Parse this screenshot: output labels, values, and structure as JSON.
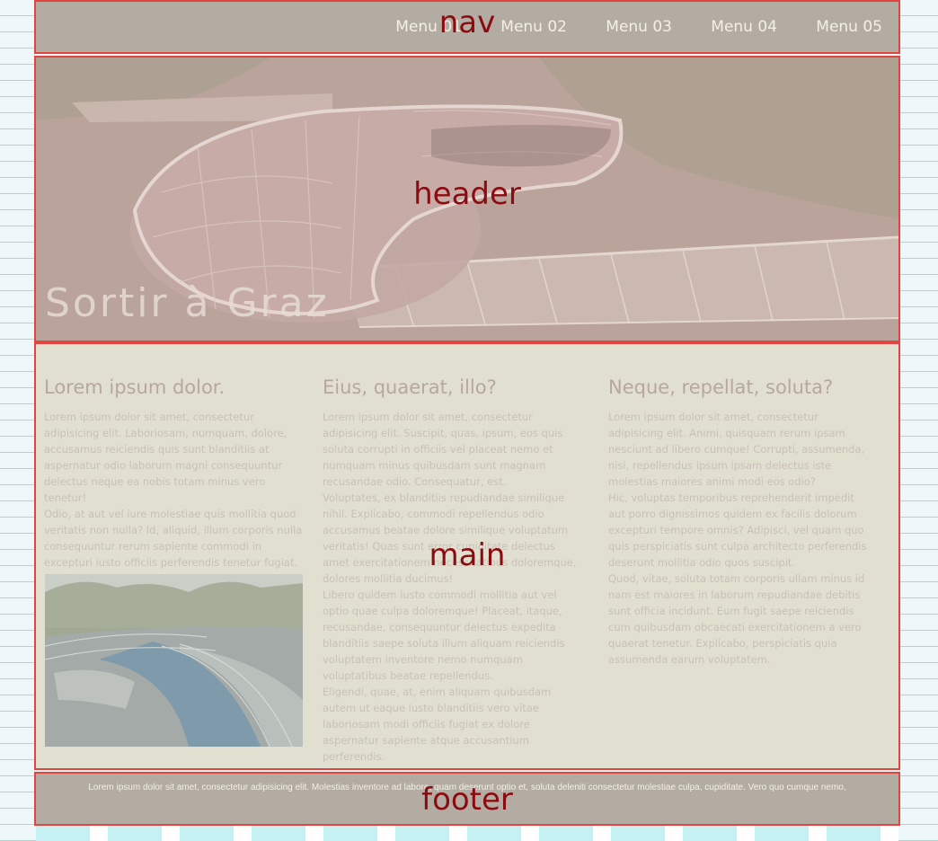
{
  "nav": {
    "label": "nav",
    "menu": [
      "Menu 01",
      "Menu 02",
      "Menu 03",
      "Menu 04",
      "Menu 05"
    ]
  },
  "header": {
    "label": "header",
    "title": "Sortir à Graz"
  },
  "main": {
    "label": "main",
    "columns": [
      {
        "heading": "Lorem ipsum dolor.",
        "paragraphs": [
          "Lorem ipsum dolor sit amet, consectetur adipisicing elit. Laboriosam, numquam, dolore, accusamus reiciendis quis sunt blanditiis at aspernatur odio laborum magni consequuntur delectus neque ea nobis totam minus vero tenetur!",
          "Odio, at aut vel iure molestiae quis mollitia quod veritatis non nulla? Id, aliquid, illum corporis nulla consequuntur rerum sapiente commodi in excepturi iusto officiis perferendis tenetur fugiat. Rem, modi?"
        ]
      },
      {
        "heading": "Eius, quaerat, illo?",
        "paragraphs": [
          "Lorem ipsum dolor sit amet, consectetur adipisicing elit. Suscipit, quas, ipsum, eos quis soluta corrupti in officiis vel placeat nemo et numquam minus quibusdam sunt magnam recusandae odio. Consequatur, est.",
          "Voluptates, ex blanditiis repudiandae similique nihil. Explicabo, commodi repellendus odio accusamus beatae dolore similique voluptatum veritatis! Quas sunt error cupiditate delectus amet exercitationem necessitatibus doloremque, dolores mollitia ducimus!",
          "Libero quidem iusto commodi mollitia aut vel optio quae culpa doloremque! Placeat, itaque, recusandae, consequuntur delectus expedita blanditiis saepe soluta illum aliquam reiciendis voluptatem inventore nemo numquam voluptatibus beatae repellendus.",
          "Eligendi, quae, at, enim aliquam quibusdam autem ut eaque iusto blanditiis vero vitae laboriosam modi officiis fugiat ex dolore aspernatur sapiente atque accusantium perferendis."
        ]
      },
      {
        "heading": "Neque, repellat, soluta?",
        "paragraphs": [
          "Lorem ipsum dolor sit amet, consectetur adipisicing elit. Animi, quisquam rerum ipsam nesciunt ad libero cumque! Corrupti, assumenda, nisi, repellendus ipsum ipsam delectus iste molestias maiores animi modi eos odio?",
          "Hic, voluptas temporibus reprehenderit impedit aut porro dignissimos quidem ex facilis dolorum excepturi tempore omnis? Adipisci, vel quam quo quis perspiciatis sunt culpa architecto perferendis deserunt mollitia odio quos suscipit.",
          "Quod, vitae, soluta totam corporis ullam minus id nam est maiores in laborum repudiandae debitis sunt officia incidunt. Eum fugit saepe reiciendis cum quibusdam obcaecati exercitationem a vero quaerat tenetur. Explicabo, perspiciatis quia assumenda earum voluptatem."
        ]
      }
    ]
  },
  "footer": {
    "label": "footer",
    "text": "Lorem ipsum dolor sit amet, consectetur adipisicing elit. Molestias inventore ad labore, quam deserunt optio et, soluta deleniti consectetur molestiae culpa, cupiditate. Vero quo cumque nemo,"
  },
  "colors": {
    "region_border": "#e2453f",
    "region_label": "#8c0b10",
    "nav_footer_bg": "#b3aca3",
    "main_bg": "#e1e0d0",
    "grid_line": "#8fe2ea"
  }
}
